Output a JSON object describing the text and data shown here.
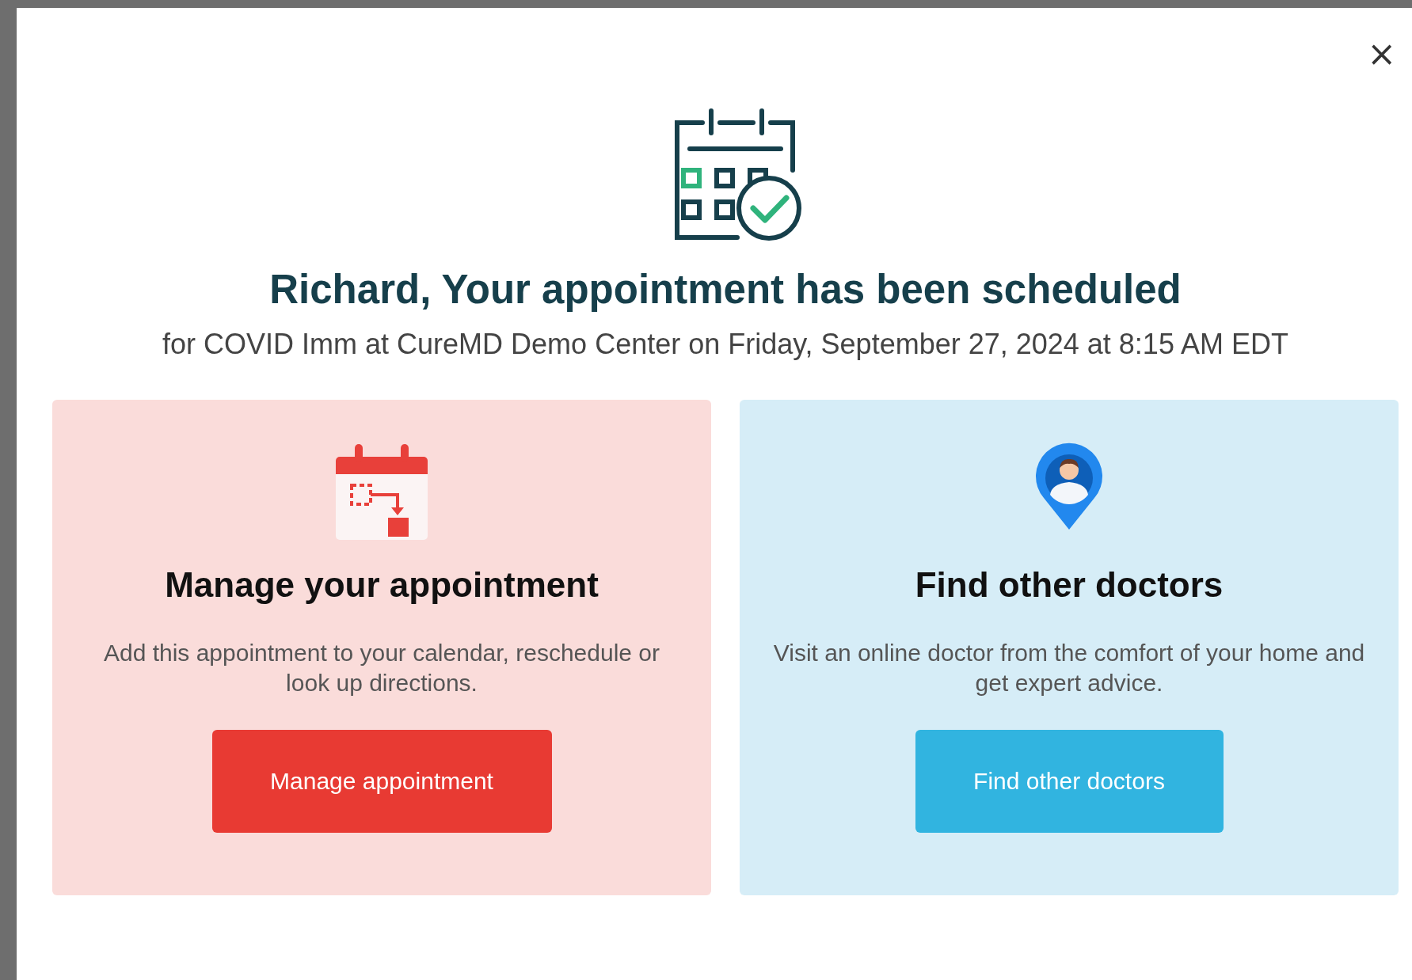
{
  "dialog": {
    "close": "×",
    "title": "Richard, Your appointment has been scheduled",
    "subtitle": "for COVID Imm at CureMD Demo Center on Friday, September 27, 2024 at 8:15 AM EDT"
  },
  "cards": [
    {
      "kind": "manage",
      "title": "Manage your appointment",
      "description": "Add this appointment to your calendar, reschedule or look up directions.",
      "button": "Manage appointment"
    },
    {
      "kind": "doctors",
      "title": "Find other doctors",
      "description": "Visit an online doctor from the comfort of your home and get expert advice.",
      "button": "Find other doctors"
    }
  ]
}
